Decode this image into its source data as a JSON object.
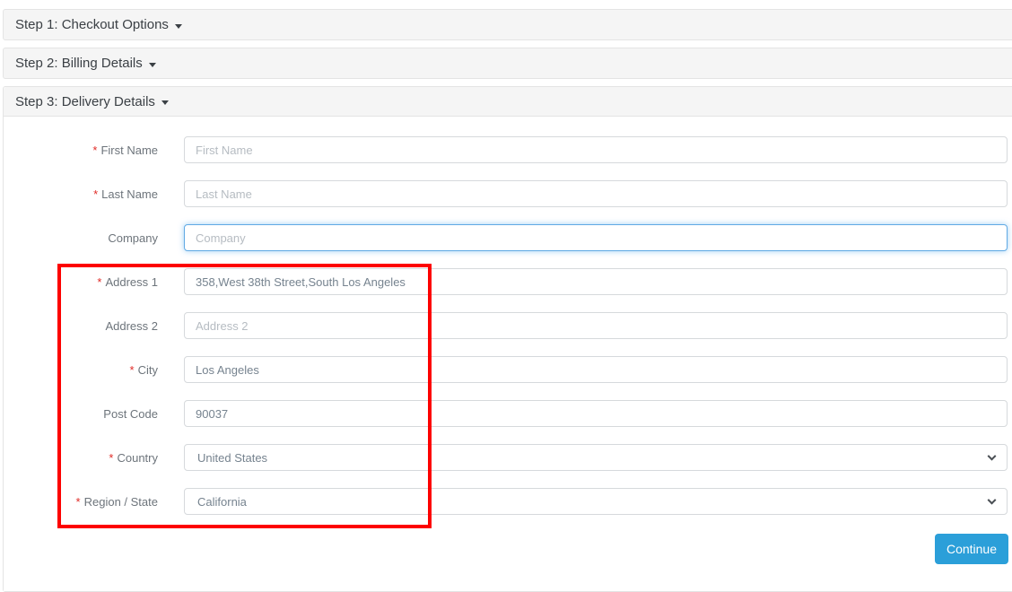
{
  "required_marker": "*",
  "accordion": {
    "step1": {
      "label": "Step 1: Checkout Options"
    },
    "step2": {
      "label": "Step 2: Billing Details"
    },
    "step3": {
      "label": "Step 3: Delivery Details"
    }
  },
  "form": {
    "first_name": {
      "label": "First Name",
      "placeholder": "First Name",
      "value": "",
      "required": true
    },
    "last_name": {
      "label": "Last Name",
      "placeholder": "Last Name",
      "value": "",
      "required": true
    },
    "company": {
      "label": "Company",
      "placeholder": "Company",
      "value": "",
      "required": false,
      "focused": true
    },
    "address_1": {
      "label": "Address 1",
      "value": "358,West 38th Street,South Los Angeles",
      "required": true
    },
    "address_2": {
      "label": "Address 2",
      "placeholder": "Address 2",
      "value": "",
      "required": false
    },
    "city": {
      "label": "City",
      "value": "Los Angeles",
      "required": true
    },
    "post_code": {
      "label": "Post Code",
      "value": "90037",
      "required": false
    },
    "country": {
      "label": "Country",
      "selected": "United States",
      "required": true
    },
    "region_state": {
      "label": "Region / State",
      "selected": "California",
      "required": true
    }
  },
  "footer": {
    "continue_label": "Continue"
  },
  "annotation": {
    "type": "highlight-rectangle",
    "color": "#fd0100"
  },
  "colors": {
    "panel_header_bg": "#f5f5f5",
    "panel_border": "#e4e4e4",
    "header_text": "#3b4045",
    "label_text": "#6d747b",
    "required_red": "#e02b27",
    "input_border": "#d6d9dc",
    "input_text": "#76838f",
    "placeholder_text": "#b6bcc2",
    "focus_blue": "#61aae4",
    "button_blue": "#2b9fd9",
    "annotation_red": "#fd0100"
  }
}
